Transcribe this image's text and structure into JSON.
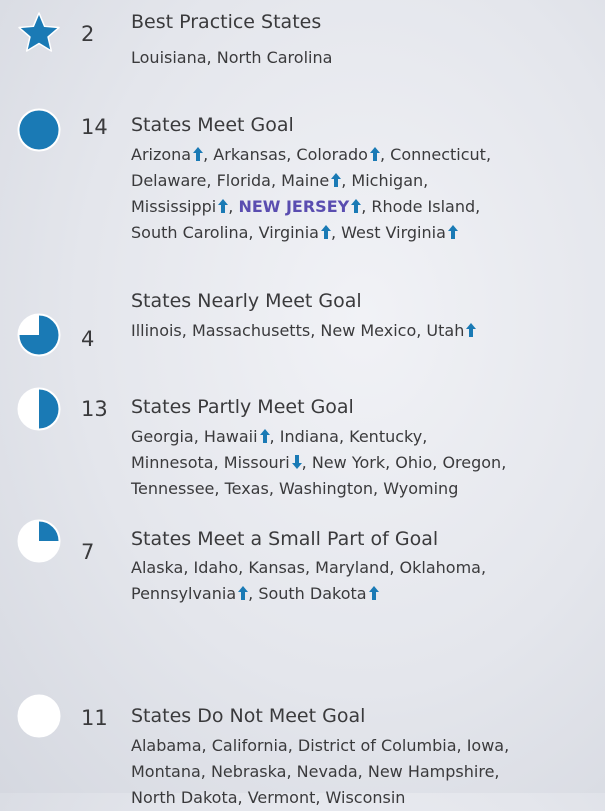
{
  "colors": {
    "fill": "#1a7ab5",
    "arrow_up": "#1a7ab5",
    "arrow_down": "#1a7ab5",
    "highlight": "#5a4db0"
  },
  "groups": [
    {
      "icon": "star-icon",
      "fill_fraction": 1,
      "count": "2",
      "title": "Best Practice States",
      "states": [
        {
          "name": "Louisiana"
        },
        {
          "name": "North Carolina"
        }
      ]
    },
    {
      "icon": "full-circle-icon",
      "fill_fraction": 1,
      "count": "14",
      "title": "States Meet Goal",
      "states": [
        {
          "name": "Arizona",
          "trend": "up"
        },
        {
          "name": "Arkansas"
        },
        {
          "name": "Colorado",
          "trend": "up"
        },
        {
          "name": "Connecticut"
        },
        {
          "name": "Delaware"
        },
        {
          "name": "Florida"
        },
        {
          "name": "Maine",
          "trend": "up"
        },
        {
          "name": "Michigan"
        },
        {
          "name": "Mississippi",
          "trend": "up"
        },
        {
          "name": "NEW JERSEY",
          "trend": "up",
          "highlight": true
        },
        {
          "name": "Rhode Island"
        },
        {
          "name": "South Carolina"
        },
        {
          "name": "Virginia",
          "trend": "up"
        },
        {
          "name": "West Virginia",
          "trend": "up"
        }
      ]
    },
    {
      "icon": "three-quarter-circle-icon",
      "fill_fraction": 0.75,
      "count": "4",
      "title": "States Nearly Meet Goal",
      "states": [
        {
          "name": "Illinois"
        },
        {
          "name": "Massachusetts"
        },
        {
          "name": "New Mexico"
        },
        {
          "name": "Utah",
          "trend": "up"
        }
      ]
    },
    {
      "icon": "half-circle-icon",
      "fill_fraction": 0.5,
      "count": "13",
      "title": "States Partly Meet Goal",
      "states": [
        {
          "name": "Georgia"
        },
        {
          "name": "Hawaii",
          "trend": "up"
        },
        {
          "name": "Indiana"
        },
        {
          "name": "Kentucky"
        },
        {
          "name": "Minnesota"
        },
        {
          "name": "Missouri",
          "trend": "down"
        },
        {
          "name": "New York"
        },
        {
          "name": "Ohio"
        },
        {
          "name": "Oregon"
        },
        {
          "name": "Tennessee"
        },
        {
          "name": "Texas"
        },
        {
          "name": "Washington"
        },
        {
          "name": "Wyoming"
        }
      ]
    },
    {
      "icon": "quarter-circle-icon",
      "fill_fraction": 0.25,
      "count": "7",
      "title": "States Meet a Small Part of Goal",
      "states": [
        {
          "name": "Alaska"
        },
        {
          "name": "Idaho"
        },
        {
          "name": "Kansas"
        },
        {
          "name": "Maryland"
        },
        {
          "name": "Oklahoma"
        },
        {
          "name": "Pennsylvania",
          "trend": "up"
        },
        {
          "name": "South Dakota",
          "trend": "up"
        }
      ]
    },
    {
      "icon": "empty-circle-icon",
      "fill_fraction": 0,
      "count": "11",
      "title": "States Do Not Meet Goal",
      "states": [
        {
          "name": "Alabama"
        },
        {
          "name": "California"
        },
        {
          "name": "District of Columbia"
        },
        {
          "name": "Iowa"
        },
        {
          "name": "Montana"
        },
        {
          "name": "Nebraska"
        },
        {
          "name": "Nevada"
        },
        {
          "name": "New Hampshire"
        },
        {
          "name": "North Dakota"
        },
        {
          "name": "Vermont"
        },
        {
          "name": "Wisconsin"
        }
      ]
    }
  ]
}
